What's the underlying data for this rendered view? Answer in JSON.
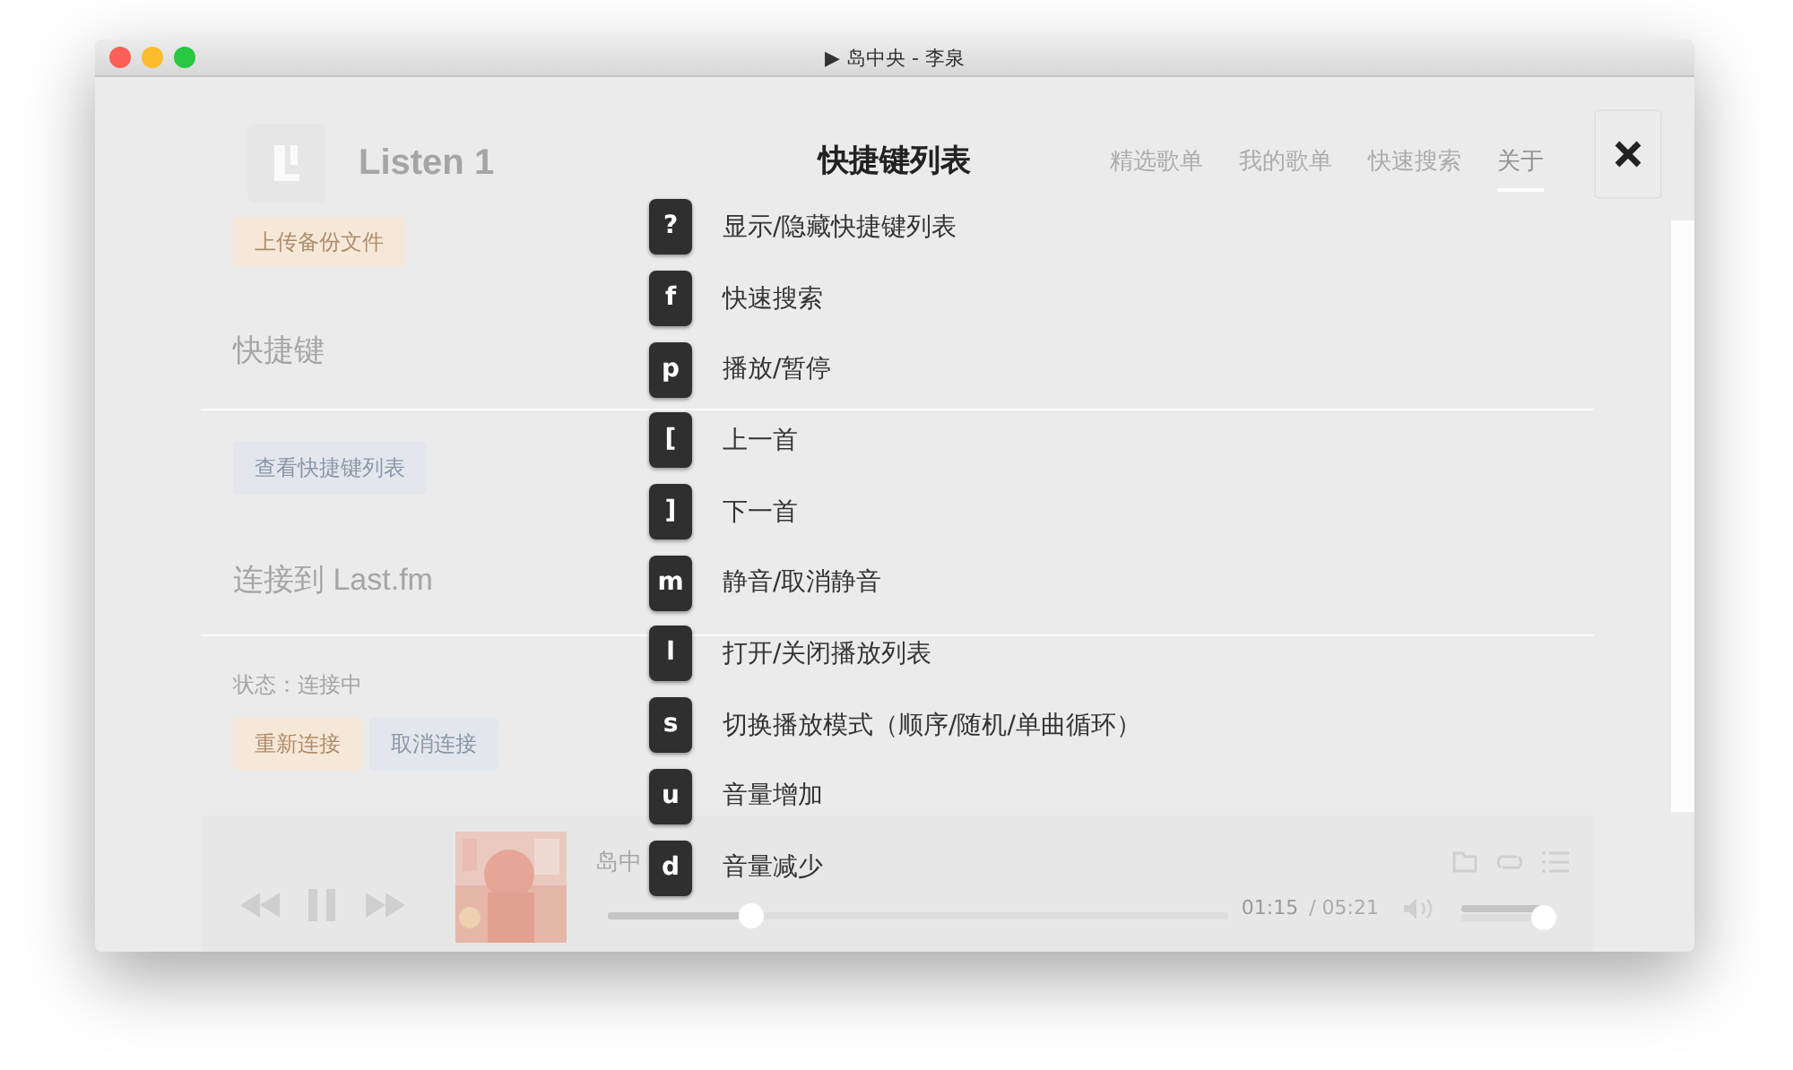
{
  "window": {
    "title": "▶ 岛中央 - 李泉"
  },
  "app": {
    "name": "Listen 1"
  },
  "nav": [
    {
      "label": "精选歌单",
      "selected": false
    },
    {
      "label": "我的歌单",
      "selected": false
    },
    {
      "label": "快速搜索",
      "selected": false
    },
    {
      "label": "关于",
      "selected": true
    }
  ],
  "settings": {
    "backup_button": "上传备份文件",
    "shortcuts_heading": "快捷键",
    "shortcuts_button": "查看快捷键列表",
    "lastfm_heading": "连接到 Last.fm",
    "status": "状态：连接中",
    "reconnect_button": "重新连接",
    "cancel_button": "取消连接"
  },
  "player": {
    "title": "岛中",
    "progress": {
      "level": 0.23
    },
    "time": "01:15",
    "duration": "/ 05:21",
    "volume": {
      "level": 1
    }
  },
  "overlay": {
    "title": "快捷键列表",
    "shortcuts": [
      {
        "key": "?",
        "label": "显示/隐藏快捷键列表"
      },
      {
        "key": "f",
        "label": "快速搜索"
      },
      {
        "key": "p",
        "label": "播放/暂停"
      },
      {
        "key": "[",
        "label": "上一首"
      },
      {
        "key": "]",
        "label": "下一首"
      },
      {
        "key": "m",
        "label": "静音/取消静音"
      },
      {
        "key": "l",
        "label": "打开/关闭播放列表"
      },
      {
        "key": "s",
        "label": "切换播放模式（顺序/随机/单曲循环）"
      },
      {
        "key": "u",
        "label": "音量增加"
      },
      {
        "key": "d",
        "label": "音量减少"
      }
    ]
  }
}
